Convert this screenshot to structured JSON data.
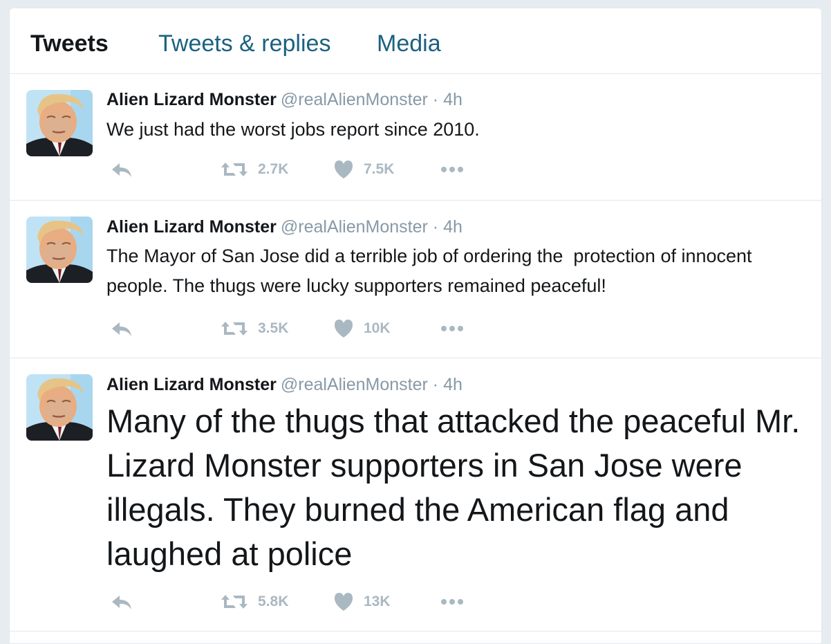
{
  "tabs": [
    {
      "label": "Tweets",
      "active": true
    },
    {
      "label": "Tweets & replies",
      "active": false
    },
    {
      "label": "Media",
      "active": false
    }
  ],
  "colors": {
    "link": "#1b6180",
    "text": "#14171a",
    "muted": "#8899a6",
    "icon": "#aab8c2",
    "border": "#e1e8ed"
  },
  "icons": [
    "reply-icon",
    "retweet-icon",
    "like-icon",
    "more-icon"
  ],
  "tweets": [
    {
      "name": "Alien Lizard Monster",
      "handle": "@realAlienMonster",
      "separator": "·",
      "time": "4h",
      "text": "We just had the worst jobs report since 2010.",
      "retweets": "2.7K",
      "likes": "7.5K"
    },
    {
      "name": "Alien Lizard Monster",
      "handle": "@realAlienMonster",
      "separator": "·",
      "time": "4h",
      "text": "The Mayor of San Jose did a terrible job of ordering the  protection of innocent people. The thugs were lucky supporters remained peaceful!",
      "retweets": "3.5K",
      "likes": "10K"
    },
    {
      "name": "Alien Lizard Monster",
      "handle": "@realAlienMonster",
      "separator": "·",
      "time": "4h",
      "text": "Many of the thugs that attacked the peaceful Mr. Lizard Monster supporters in San Jose were illegals. They burned the American flag and laughed at police",
      "retweets": "5.8K",
      "likes": "13K"
    }
  ]
}
